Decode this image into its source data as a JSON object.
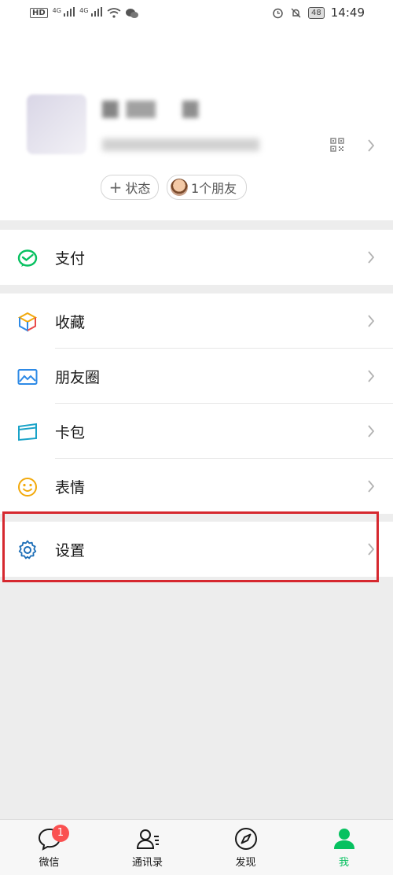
{
  "status_bar": {
    "time": "14:49",
    "battery": "48",
    "network": [
      "HD",
      "4G",
      "4G"
    ]
  },
  "profile": {
    "status_chip": "状态",
    "friends_chip": "1个朋友"
  },
  "menu": {
    "pay": "支付",
    "favorites": "收藏",
    "moments": "朋友圈",
    "cards": "卡包",
    "stickers": "表情",
    "settings": "设置"
  },
  "tabbar": {
    "chats": "微信",
    "chats_badge": "1",
    "contacts": "通讯录",
    "discover": "发现",
    "me": "我"
  },
  "colors": {
    "accent": "#07c160",
    "badge": "#fa5151",
    "highlight": "#d6282f"
  }
}
